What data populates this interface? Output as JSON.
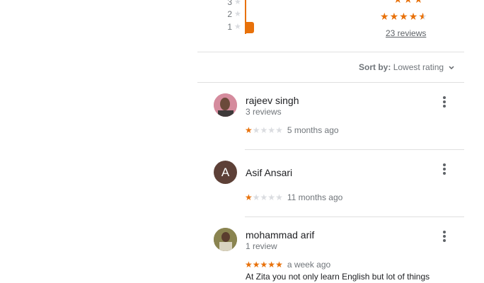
{
  "histogram": {
    "rows": [
      {
        "label": "3",
        "count_fraction": 0
      },
      {
        "label": "2",
        "count_fraction": 0
      },
      {
        "label": "1",
        "count_fraction": 0.05
      }
    ],
    "accent_color": "#e8710a"
  },
  "summary": {
    "stars_display": "★★★★★",
    "top_stars_display": "★★★",
    "rating_stars": 4.5,
    "reviews_link": "23 reviews"
  },
  "sort": {
    "label": "Sort by:",
    "value": "Lowest rating",
    "chevron_icon": "chevron-down-icon"
  },
  "reviews": [
    {
      "name": "rajeev singh",
      "count": "3 reviews",
      "rating": 1,
      "time": "5 months ago",
      "avatar_type": "photo",
      "avatar_bg": "#c2185b"
    },
    {
      "name": "Asif Ansari",
      "count": "",
      "rating": 1,
      "time": "11 months ago",
      "avatar_type": "letter",
      "avatar_letter": "A",
      "avatar_bg": "#5d4037"
    },
    {
      "name": "mohammad arif",
      "count": "1 review",
      "rating": 5,
      "time": "a week ago",
      "avatar_type": "photo",
      "avatar_bg": "#6d6d3b",
      "text": "At Zita you not only learn English but lot of things"
    }
  ]
}
